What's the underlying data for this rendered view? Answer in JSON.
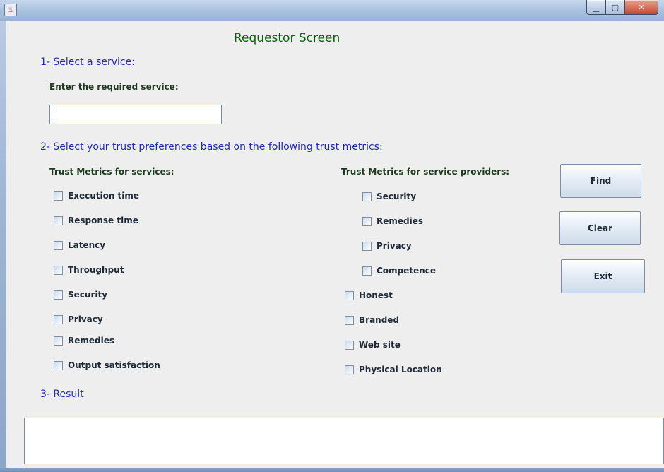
{
  "window": {
    "app_icon": "java-icon",
    "title": "",
    "controls": {
      "minimize": "minimize-icon",
      "maximize": "maximize-icon",
      "close": "close-icon"
    }
  },
  "heading": "Requestor Screen",
  "step1": {
    "title": "1- Select a service:",
    "field_label": "Enter the required service:",
    "field_value": ""
  },
  "step2": {
    "title": "2- Select your trust preferences based on the following trust metrics:",
    "services": {
      "header": "Trust Metrics for services:",
      "items": [
        {
          "label": "Execution time",
          "checked": false
        },
        {
          "label": "Response time",
          "checked": false
        },
        {
          "label": "Latency",
          "checked": false
        },
        {
          "label": "Throughput",
          "checked": false
        },
        {
          "label": "Security",
          "checked": false
        },
        {
          "label": "Privacy",
          "checked": false
        },
        {
          "label": "Remedies",
          "checked": false
        },
        {
          "label": "Output satisfaction",
          "checked": false
        }
      ]
    },
    "providers": {
      "header": "Trust Metrics for service providers:",
      "items": [
        {
          "label": "Security",
          "checked": false
        },
        {
          "label": "Remedies",
          "checked": false
        },
        {
          "label": "Privacy",
          "checked": false
        },
        {
          "label": "Competence",
          "checked": false
        },
        {
          "label": "Honest",
          "checked": false
        },
        {
          "label": "Branded",
          "checked": false
        },
        {
          "label": "Web site",
          "checked": false
        },
        {
          "label": "Physical Location",
          "checked": false
        }
      ]
    }
  },
  "buttons": {
    "find": "Find",
    "clear": "Clear",
    "exit": "Exit"
  },
  "step3": {
    "title": "3- Result",
    "value": ""
  },
  "colors": {
    "heading": "#0b610b",
    "section": "#1f2bb0",
    "background": "#eeeeee"
  }
}
